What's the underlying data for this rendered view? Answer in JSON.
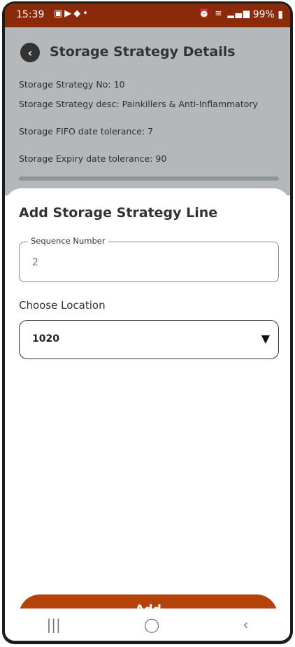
{
  "status_bar": {
    "time": "15:39",
    "battery": "99%",
    "left_icons": [
      "image-icon",
      "video-icon",
      "bag-icon",
      "dot-icon"
    ],
    "right_icons": [
      "alarm-icon",
      "wifi-icon",
      "signal-icon"
    ]
  },
  "header": {
    "title": "Storage Strategy Details"
  },
  "details": {
    "line1": "Storage Strategy No: 10",
    "line2": "Storage Strategy desc: Painkillers & Anti-Inflammatory",
    "line3": "Storage FIFO date tolerance: 7",
    "line4": "Storage Expiry date tolerance: 90"
  },
  "sheet": {
    "title": "Add Storage Strategy Line",
    "sequence_label": "Sequence Number",
    "sequence_placeholder": "2",
    "location_label": "Choose Location",
    "location_value": "1020",
    "add_label": "Add"
  },
  "colors": {
    "status_bar": "#8a2a0b",
    "accent": "#b3420b",
    "overlay": "#b4b8bb"
  }
}
